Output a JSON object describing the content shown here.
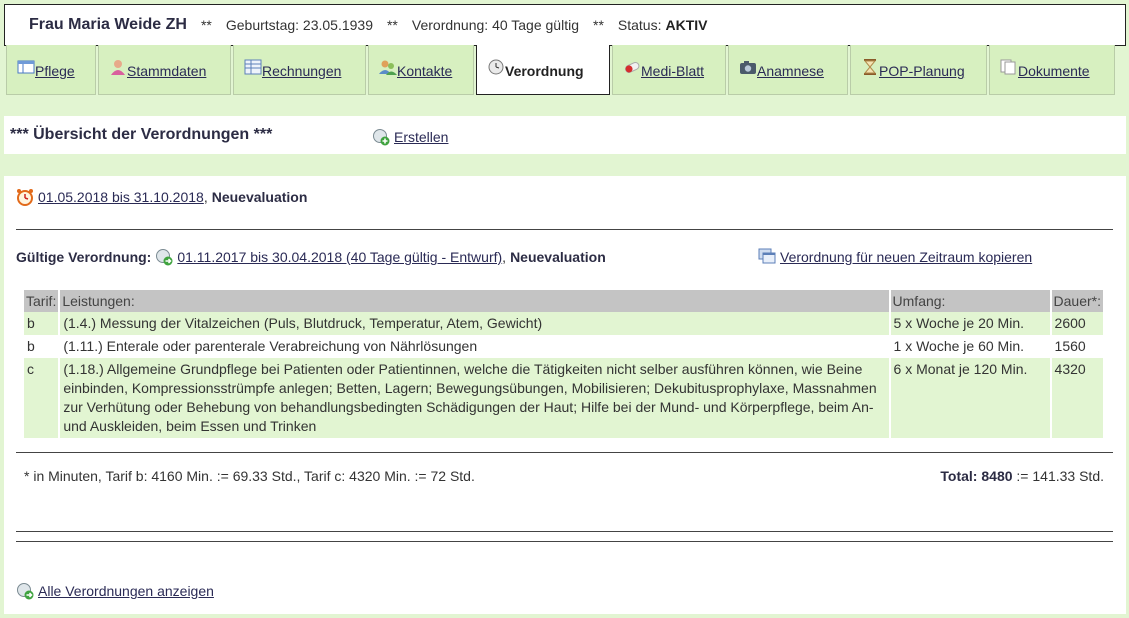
{
  "patient": {
    "name": "Frau Maria Weide ZH",
    "separator": "**",
    "birthday": "Geburtstag: 23.05.1939",
    "order": "Verordnung: 40 Tage gültig",
    "status_label": "Status:",
    "status_value": "AKTIV"
  },
  "tabs": [
    {
      "label": "Pflege",
      "icon": "table-icon"
    },
    {
      "label": "Stammdaten",
      "icon": "person-icon"
    },
    {
      "label": "Rechnungen",
      "icon": "spreadsheet-icon"
    },
    {
      "label": "Kontakte",
      "icon": "contacts-icon"
    },
    {
      "label": "Verordnung",
      "icon": "clock-icon",
      "active": true
    },
    {
      "label": "Medi-Blatt",
      "icon": "pill-icon"
    },
    {
      "label": "Anamnese",
      "icon": "camera-icon"
    },
    {
      "label": "POP-Planung",
      "icon": "hourglass-icon"
    },
    {
      "label": "Dokumente",
      "icon": "documents-icon"
    }
  ],
  "overview": {
    "title": "*** Übersicht der Verordnungen ***",
    "create_label": "Erstellen"
  },
  "period1": {
    "link": "01.05.2018 bis 31.10.2018",
    "sep": ",",
    "type": "Neuevaluation"
  },
  "valid": {
    "label": "Gültige Verordnung:",
    "link": "01.11.2017 bis 30.04.2018 (40 Tage gültig - Entwurf)",
    "sep": ",",
    "type": "Neuevaluation",
    "copy_label": "Verordnung für neuen Zeitraum kopieren"
  },
  "table": {
    "headers": [
      "Tarif:",
      "Leistungen:",
      "Umfang:",
      "Dauer*:"
    ],
    "rows": [
      {
        "tarif": "b",
        "service": "(1.4.) Messung der Vitalzeichen (Puls, Blutdruck, Temperatur, Atem, Gewicht)",
        "scope": "5 x Woche je 20 Min.",
        "duration": "2600"
      },
      {
        "tarif": "b",
        "service": "(1.11.) Enterale oder parenterale Verabreichung von Nährlösungen",
        "scope": "1 x Woche je 60 Min.",
        "duration": "1560"
      },
      {
        "tarif": "c",
        "service": "(1.18.) Allgemeine Grundpflege bei Patienten oder Patientinnen, welche die Tätigkeiten nicht selber ausführen können, wie Beine einbinden, Kompressionsstrümpfe anlegen; Betten, Lagern; Bewegungsübungen, Mobilisieren; Dekubitusprophylaxe, Massnahmen zur Verhütung oder Behebung von behandlungsbedingten Schädigungen der Haut; Hilfe bei der Mund- und Körperpflege, beim An- und Auskleiden, beim Essen und Trinken",
        "scope": "6 x Monat je 120 Min.",
        "duration": "4320"
      }
    ]
  },
  "footnote": "* in Minuten, Tarif b: 4160 Min. := 69.33 Std., Tarif c: 4320 Min. := 72 Std.",
  "total": {
    "label": "Total:",
    "value": "8480",
    "suffix": ":= 141.33 Std."
  },
  "show_all_label": "Alle Verordnungen anzeigen"
}
